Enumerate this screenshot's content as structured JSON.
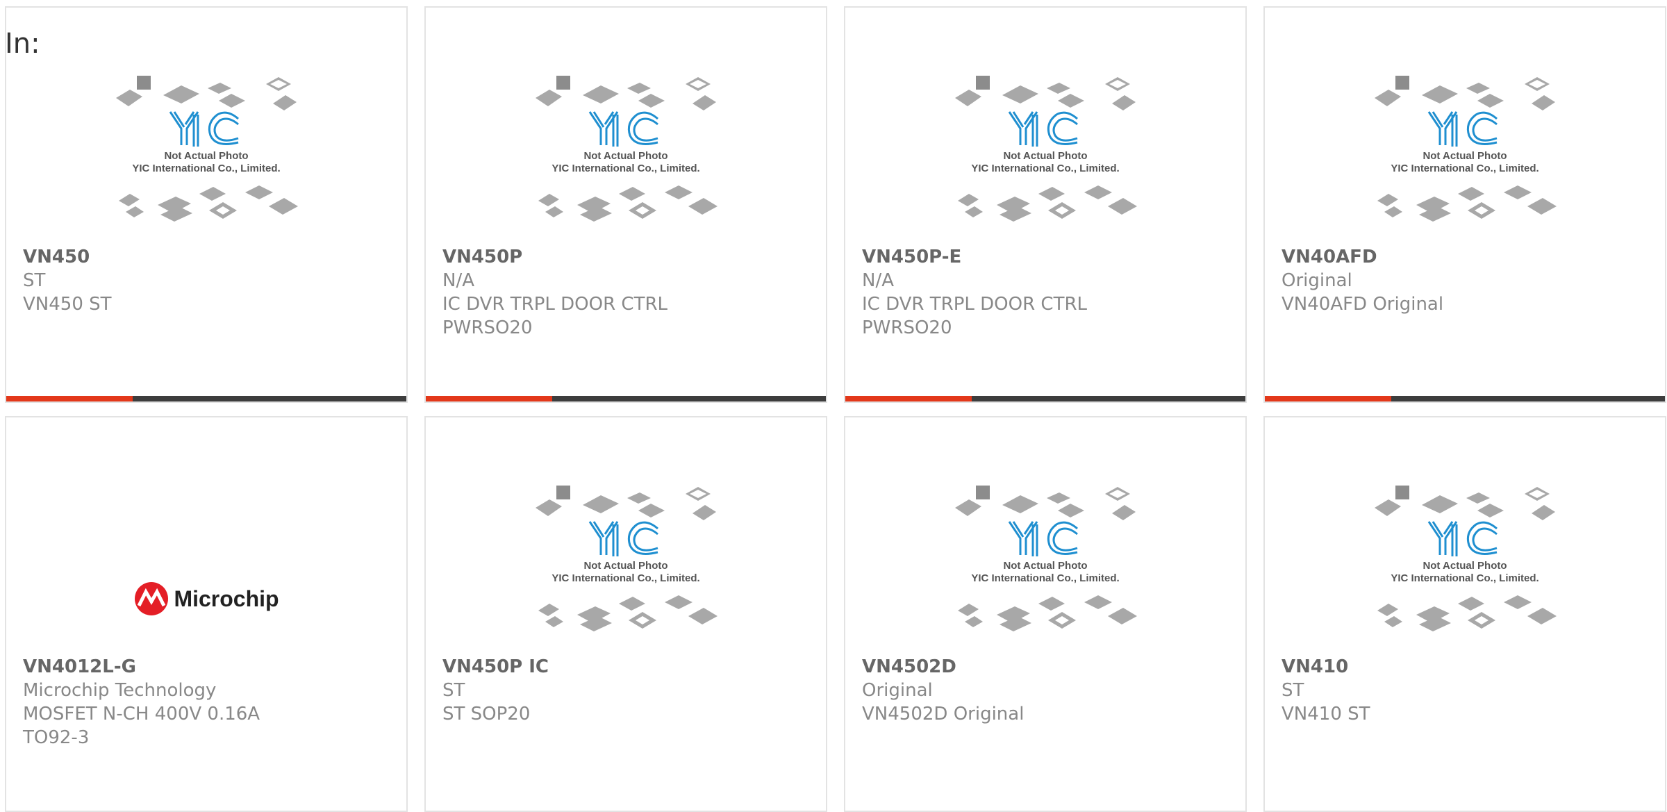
{
  "header": {
    "in_label": "In:"
  },
  "placeholder": {
    "line1": "Not Actual Photo",
    "line2": "YIC International Co., Limited.",
    "brand": "YIC"
  },
  "colors": {
    "accent": "#e3381a",
    "bar": "#3d3d3d",
    "yic_blue": "#1f8fd0",
    "microchip_red": "#e41e26"
  },
  "cards": [
    {
      "part": "VN450",
      "maker": "ST",
      "desc": "VN450 ST",
      "image": "yic-placeholder"
    },
    {
      "part": "VN450P",
      "maker": "N/A",
      "desc": "IC DVR TRPL DOOR CTRL PWRSO20",
      "image": "yic-placeholder"
    },
    {
      "part": "VN450P-E",
      "maker": "N/A",
      "desc": "IC DVR TRPL DOOR CTRL PWRSO20",
      "image": "yic-placeholder"
    },
    {
      "part": "VN40AFD",
      "maker": "Original",
      "desc": "VN40AFD Original",
      "image": "yic-placeholder"
    },
    {
      "part": "VN4012L-G",
      "maker": "Microchip Technology",
      "desc": "MOSFET N-CH 400V 0.16A TO92-3",
      "image": "microchip-logo",
      "logo_text": "Microchip"
    },
    {
      "part": "VN450P IC",
      "maker": "ST",
      "desc": "ST SOP20",
      "image": "yic-placeholder"
    },
    {
      "part": "VN4502D",
      "maker": "Original",
      "desc": "VN4502D Original",
      "image": "yic-placeholder"
    },
    {
      "part": "VN410",
      "maker": "ST",
      "desc": "VN410 ST",
      "image": "yic-placeholder"
    }
  ]
}
